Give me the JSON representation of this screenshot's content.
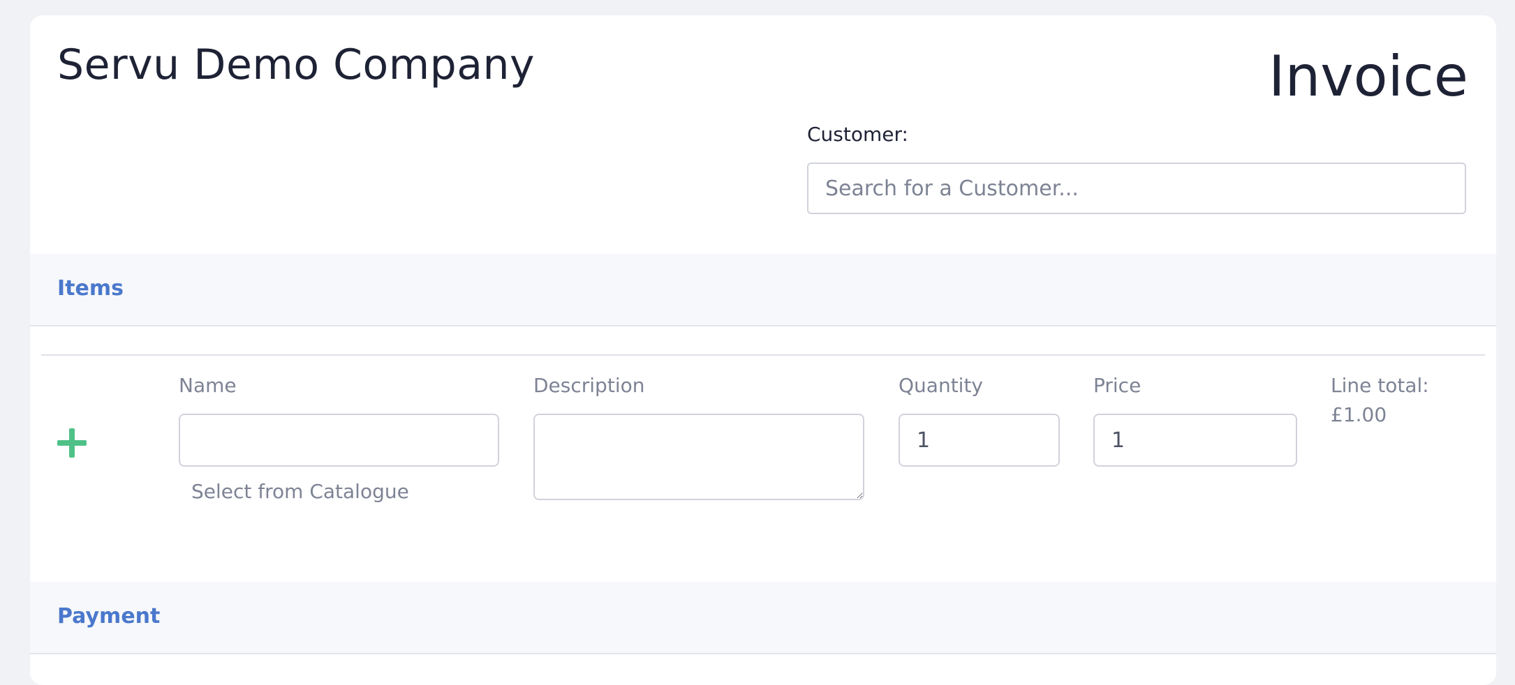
{
  "header": {
    "company_name": "Servu Demo Company",
    "document_type": "Invoice"
  },
  "customer": {
    "label": "Customer:",
    "placeholder": "Search for a Customer..."
  },
  "items_section": {
    "title": "Items",
    "columns": {
      "name": "Name",
      "description": "Description",
      "quantity": "Quantity",
      "price": "Price",
      "line_total": "Line total:"
    },
    "line": {
      "name_value": "",
      "description_value": "",
      "quantity_value": "1",
      "price_value": "1",
      "line_total_value": "£1.00",
      "catalogue_link": "Select from Catalogue"
    }
  },
  "payment_section": {
    "title": "Payment"
  },
  "colors": {
    "accent": "#4a78cc",
    "add_icon": "#4fc188",
    "background": "#f1f2f6"
  },
  "icons": {
    "add_line": "plus-icon"
  }
}
